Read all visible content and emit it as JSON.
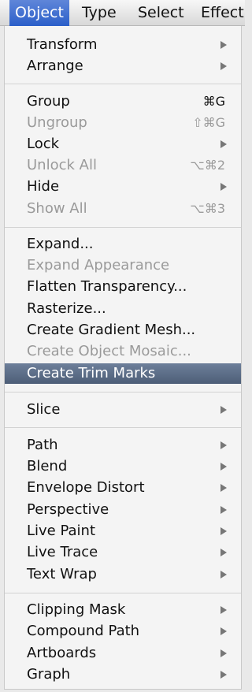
{
  "menubar": {
    "items": [
      "Object",
      "Type",
      "Select",
      "Effect"
    ]
  },
  "menu": {
    "items": [
      {
        "label": "Transform",
        "submenu": true
      },
      {
        "label": "Arrange",
        "submenu": true
      },
      {
        "label": "Group",
        "shortcut": "⌘G"
      },
      {
        "label": "Ungroup",
        "shortcut": "⇧⌘G",
        "disabled": true
      },
      {
        "label": "Lock",
        "submenu": true
      },
      {
        "label": "Unlock All",
        "shortcut": "⌥⌘2",
        "disabled": true
      },
      {
        "label": "Hide",
        "submenu": true
      },
      {
        "label": "Show All",
        "shortcut": "⌥⌘3",
        "disabled": true
      },
      {
        "label": "Expand..."
      },
      {
        "label": "Expand Appearance",
        "disabled": true
      },
      {
        "label": "Flatten Transparency..."
      },
      {
        "label": "Rasterize..."
      },
      {
        "label": "Create Gradient Mesh..."
      },
      {
        "label": "Create Object Mosaic...",
        "disabled": true
      },
      {
        "label": "Create Trim Marks",
        "highlighted": true
      },
      {
        "label": "Slice",
        "submenu": true
      },
      {
        "label": "Path",
        "submenu": true
      },
      {
        "label": "Blend",
        "submenu": true
      },
      {
        "label": "Envelope Distort",
        "submenu": true
      },
      {
        "label": "Perspective",
        "submenu": true
      },
      {
        "label": "Live Paint",
        "submenu": true
      },
      {
        "label": "Live Trace",
        "submenu": true
      },
      {
        "label": "Text Wrap",
        "submenu": true
      },
      {
        "label": "Clipping Mask",
        "submenu": true
      },
      {
        "label": "Compound Path",
        "submenu": true
      },
      {
        "label": "Artboards",
        "submenu": true
      },
      {
        "label": "Graph",
        "submenu": true
      }
    ]
  }
}
